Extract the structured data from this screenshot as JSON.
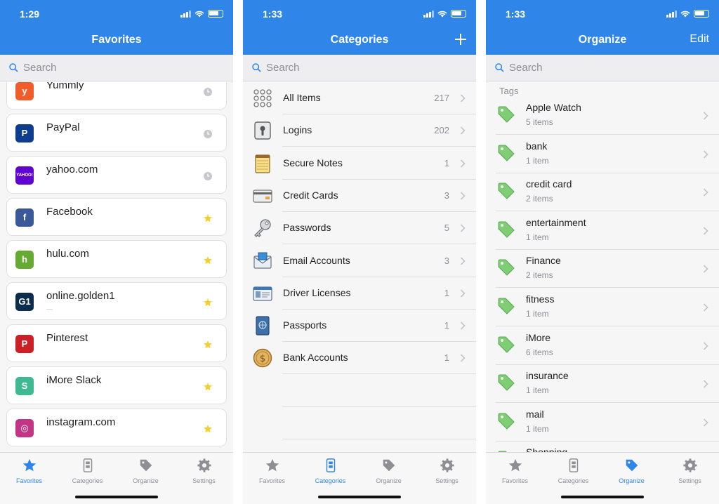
{
  "colors": {
    "accent": "#2f86e8",
    "tag_green": "#7fce74",
    "star": "#f5cf2a"
  },
  "favorites": {
    "time": "1:29",
    "title": "Favorites",
    "search_placeholder": "Search",
    "items": [
      {
        "name": "Yummly",
        "sub": "",
        "logo_text": "y",
        "logo_color": "#f15c2b",
        "mark": "clock"
      },
      {
        "name": "PayPal",
        "sub": "",
        "logo_text": "P",
        "logo_color": "#0e3d8f",
        "mark": "clock"
      },
      {
        "name": "yahoo.com",
        "sub": "",
        "logo_text": "YAHOO!",
        "logo_color": "#5f01d1",
        "mark": "clock"
      },
      {
        "name": "Facebook",
        "sub": "",
        "logo_text": "f",
        "logo_color": "#3b5998",
        "mark": "star"
      },
      {
        "name": "hulu.com",
        "sub": "",
        "logo_text": "h",
        "logo_color": "#66aa33",
        "mark": "star"
      },
      {
        "name": "online.golden1",
        "sub": "—",
        "logo_text": "G1",
        "logo_color": "#0d2d4d",
        "mark": "star"
      },
      {
        "name": "Pinterest",
        "sub": "",
        "logo_text": "P",
        "logo_color": "#cb2027",
        "mark": "star"
      },
      {
        "name": "iMore Slack",
        "sub": "",
        "logo_text": "S",
        "logo_color": "#3eb991",
        "mark": "star"
      },
      {
        "name": "instagram.com",
        "sub": "",
        "logo_text": "◎",
        "logo_color": "#c13584",
        "mark": "star"
      }
    ]
  },
  "categories": {
    "time": "1:33",
    "title": "Categories",
    "search_placeholder": "Search",
    "items": [
      {
        "label": "All Items",
        "count": "217",
        "icon": "all-items-icon"
      },
      {
        "label": "Logins",
        "count": "202",
        "icon": "login-icon"
      },
      {
        "label": "Secure Notes",
        "count": "1",
        "icon": "secure-note-icon"
      },
      {
        "label": "Credit Cards",
        "count": "3",
        "icon": "credit-card-icon"
      },
      {
        "label": "Passwords",
        "count": "5",
        "icon": "key-icon"
      },
      {
        "label": "Email Accounts",
        "count": "3",
        "icon": "email-icon"
      },
      {
        "label": "Driver Licenses",
        "count": "1",
        "icon": "driver-license-icon"
      },
      {
        "label": "Passports",
        "count": "1",
        "icon": "passport-icon"
      },
      {
        "label": "Bank Accounts",
        "count": "1",
        "icon": "bank-icon"
      }
    ]
  },
  "organize": {
    "time": "1:33",
    "title": "Organize",
    "edit_label": "Edit",
    "search_placeholder": "Search",
    "tags_header": "Tags",
    "tags": [
      {
        "name": "Apple Watch",
        "count": "5 items"
      },
      {
        "name": "bank",
        "count": "1 item"
      },
      {
        "name": "credit card",
        "count": "2 items"
      },
      {
        "name": "entertainment",
        "count": "1 item"
      },
      {
        "name": "Finance",
        "count": "2 items"
      },
      {
        "name": "fitness",
        "count": "1 item"
      },
      {
        "name": "iMore",
        "count": "6 items"
      },
      {
        "name": "insurance",
        "count": "1 item"
      },
      {
        "name": "mail",
        "count": "1 item"
      },
      {
        "name": "Shopping",
        "count": ""
      }
    ]
  },
  "tabbar": {
    "favorites": "Favorites",
    "categories": "Categories",
    "organize": "Organize",
    "settings": "Settings"
  }
}
